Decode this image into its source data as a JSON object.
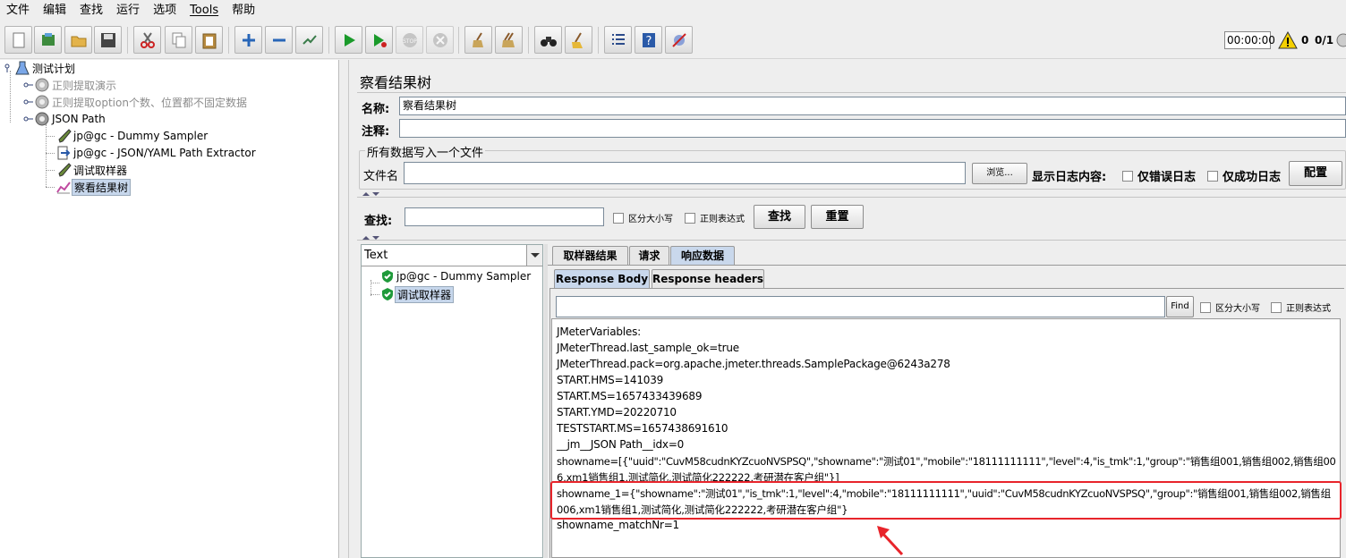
{
  "menu": [
    "文件",
    "编辑",
    "查找",
    "运行",
    "选项",
    "Tools",
    "帮助"
  ],
  "toolbar": {
    "timer": "00:00:00",
    "warn_count": "0",
    "threads": "0/1"
  },
  "tree": {
    "root": "测试计划",
    "items": [
      {
        "label": "正则提取演示",
        "disabled": true
      },
      {
        "label": "正则提取option个数、位置都不固定数据",
        "disabled": true
      },
      {
        "label": "JSON Path",
        "disabled": false
      }
    ],
    "children": [
      {
        "label": "jp@gc - Dummy Sampler"
      },
      {
        "label": "jp@gc - JSON/YAML Path Extractor"
      },
      {
        "label": "调试取样器"
      },
      {
        "label": "察看结果树"
      }
    ]
  },
  "panel": {
    "title": "察看结果树",
    "name_label": "名称:",
    "name_value": "察看结果树",
    "comment_label": "注释:",
    "comment_value": "",
    "file_group": "所有数据写入一个文件",
    "file_label": "文件名",
    "file_value": "",
    "browse": "浏览...",
    "log_label": "显示日志内容:",
    "errors_only": "仅错误日志",
    "success_only": "仅成功日志",
    "configure": "配置"
  },
  "search": {
    "label": "查找:",
    "value": "",
    "case": "区分大小写",
    "regex": "正则表达式",
    "find": "查找",
    "reset": "重置"
  },
  "results": {
    "renderer": "Text",
    "samples": [
      "jp@gc - Dummy Sampler",
      "调试取样器"
    ]
  },
  "tabs": {
    "sampler_result": "取样器结果",
    "request": "请求",
    "response_data": "响应数据"
  },
  "subtabs": {
    "body": "Response Body",
    "headers": "Response headers"
  },
  "response_find": {
    "find": "Find",
    "case": "区分大小写",
    "regex": "正则表达式",
    "value": ""
  },
  "response_lines": [
    "JMeterVariables:",
    "JMeterThread.last_sample_ok=true",
    "JMeterThread.pack=org.apache.jmeter.threads.SamplePackage@6243a278",
    "START.HMS=141039",
    "START.MS=1657433439689",
    "START.YMD=20220710",
    "TESTSTART.MS=1657438691610",
    "__jm__JSON Path__idx=0",
    "showname=[{\"uuid\":\"CuvM58cudnKYZcuoNVSPSQ\",\"showname\":\"测试01\",\"mobile\":\"18111111111\",\"level\":4,\"is_tmk\":1,\"group\":\"销售组001,销售组002,销售组00",
    "6,xm1销售组1,测试简化,测试简化222222,考研潜在客户组\"}]",
    "showname_1={\"showname\":\"测试01\",\"is_tmk\":1,\"level\":4,\"mobile\":\"18111111111\",\"uuid\":\"CuvM58cudnKYZcuoNVSPSQ\",\"group\":\"销售组001,销售组002,销售组",
    "006,xm1销售组1,测试简化,测试简化222222,考研潜在客户组\"}",
    "showname_matchNr=1"
  ],
  "colors": {
    "highlight": "#e8242b",
    "selection": "#c7d7ec"
  }
}
